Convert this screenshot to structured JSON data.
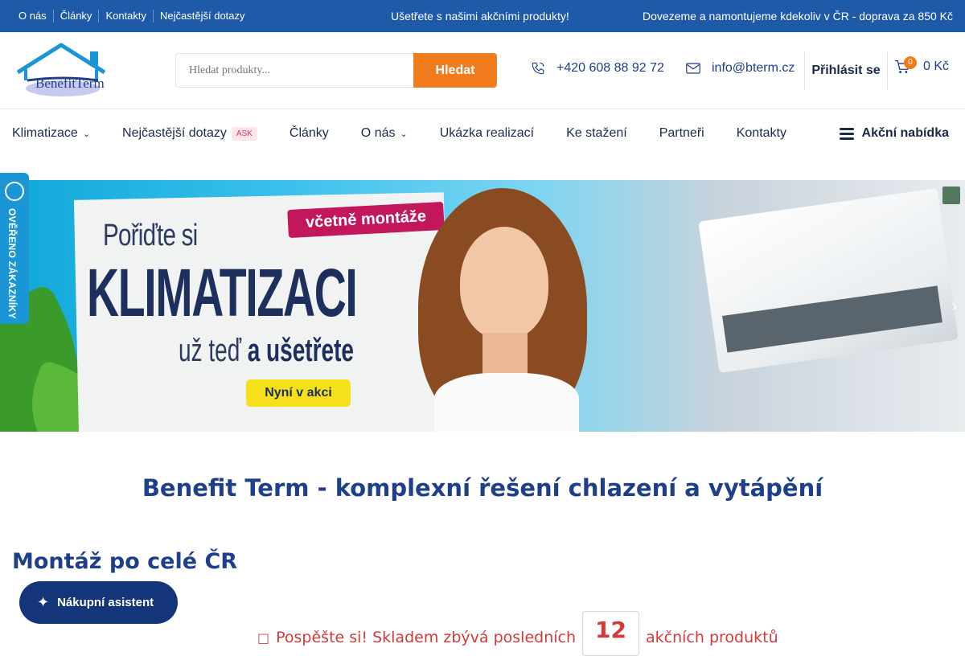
{
  "topbar": {
    "links": [
      "O nás",
      "Články",
      "Kontakty",
      "Nejčastější dotazy"
    ],
    "promo": "Ušetřete s našimi akčními produkty!",
    "delivery": "Dovezeme a namontujeme kdekoliv v ČR - doprava za 850 Kč"
  },
  "header": {
    "brand": "BenefitTerm",
    "search_placeholder": "Hledat produkty...",
    "search_button": "Hledat",
    "phone": "+420 608 88 92 72",
    "email": "info@bterm.cz",
    "login": "Přihlásit se",
    "cart_count": "0",
    "cart_total": "0 Kč"
  },
  "nav": {
    "items": [
      {
        "label": "Klimatizace",
        "has_dropdown": true
      },
      {
        "label": "Nejčastější dotazy",
        "tag": "ASK"
      },
      {
        "label": "Články"
      },
      {
        "label": "O nás",
        "has_dropdown": true
      },
      {
        "label": "Ukázka realizací"
      },
      {
        "label": "Ke stažení"
      },
      {
        "label": "Partneři"
      },
      {
        "label": "Kontakty"
      }
    ],
    "offer": "Akční nabídka"
  },
  "hero": {
    "badge": "včetně montáže",
    "line1": "Pořiďte si",
    "line2": "KLIMATIZACI",
    "line3_a": "už teď",
    "line3_b": "a ušetřete",
    "cta": "Nyní v akci"
  },
  "verified": {
    "label": "OVĚŘENO ZÁKAZNÍKY"
  },
  "main": {
    "tagline": "Benefit Term - komplexní řešení chlazení a vytápění",
    "subheading": "Montáž po celé ČR",
    "hurry_lead": "Pospěšte si! Skladem zbývá posledních",
    "hurry_count": "12",
    "hurry_tail": "akčních produktů"
  },
  "assistant": {
    "label": "Nákupní asistent"
  },
  "colors": {
    "topbar": "#1e5aa8",
    "accent": "#f07c1e",
    "navy": "#1e3f8a",
    "alert": "#d43a3a",
    "assistant": "#15357a"
  }
}
